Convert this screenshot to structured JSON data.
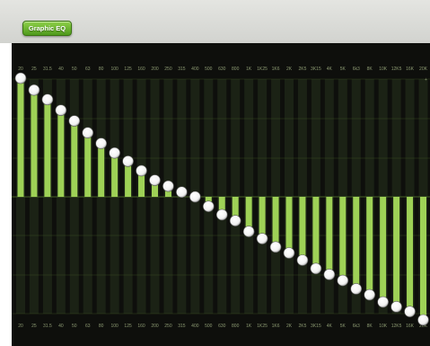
{
  "header": {
    "title_button": "Graphic EQ"
  },
  "eq": {
    "colors": {
      "panel": "#0e0f0c",
      "bar_fill": "#9ed156",
      "band_lane": "#1b2215",
      "grid_line": "#4b6a2a",
      "label": "#8c9a72",
      "knob": "#f2f2f2"
    },
    "db_labels": [
      "+",
      "",
      "",
      "",
      "",
      "",
      "",
      "",
      "+"
    ],
    "bands": [
      {
        "freq": "20",
        "gain": 1.0
      },
      {
        "freq": "25",
        "gain": 0.9
      },
      {
        "freq": "31.5",
        "gain": 0.82
      },
      {
        "freq": "40",
        "gain": 0.73
      },
      {
        "freq": "50",
        "gain": 0.64
      },
      {
        "freq": "63",
        "gain": 0.54
      },
      {
        "freq": "80",
        "gain": 0.45
      },
      {
        "freq": "100",
        "gain": 0.37
      },
      {
        "freq": "125",
        "gain": 0.3
      },
      {
        "freq": "160",
        "gain": 0.22
      },
      {
        "freq": "200",
        "gain": 0.14
      },
      {
        "freq": "250",
        "gain": 0.09
      },
      {
        "freq": "315",
        "gain": 0.04
      },
      {
        "freq": "400",
        "gain": 0.0
      },
      {
        "freq": "500",
        "gain": -0.08
      },
      {
        "freq": "630",
        "gain": -0.15
      },
      {
        "freq": "800",
        "gain": -0.2
      },
      {
        "freq": "1K",
        "gain": -0.29
      },
      {
        "freq": "1K25",
        "gain": -0.35
      },
      {
        "freq": "1K6",
        "gain": -0.42
      },
      {
        "freq": "2K",
        "gain": -0.47
      },
      {
        "freq": "2K5",
        "gain": -0.53
      },
      {
        "freq": "3K15",
        "gain": -0.6
      },
      {
        "freq": "4K",
        "gain": -0.65
      },
      {
        "freq": "5K",
        "gain": -0.7
      },
      {
        "freq": "6k3",
        "gain": -0.77
      },
      {
        "freq": "8K",
        "gain": -0.82
      },
      {
        "freq": "10K",
        "gain": -0.88
      },
      {
        "freq": "12K5",
        "gain": -0.92
      },
      {
        "freq": "16K",
        "gain": -0.96
      },
      {
        "freq": "20K",
        "gain": -1.03
      }
    ]
  }
}
